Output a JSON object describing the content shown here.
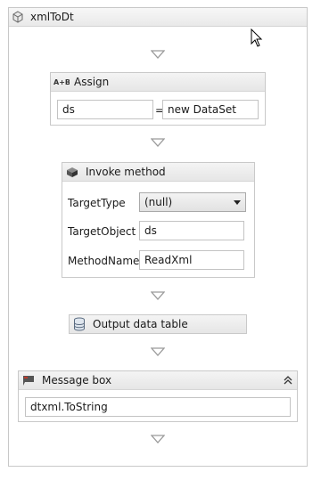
{
  "sequence": {
    "title": "xmlToDt",
    "icon": "sequence-icon"
  },
  "assign": {
    "title": "Assign",
    "icon": "assign-icon",
    "icon_text": "A+B",
    "to_value": "ds",
    "equals": "=",
    "value": "new DataSet"
  },
  "invoke": {
    "title": "Invoke method",
    "icon": "invoke-method-icon",
    "target_type_label": "TargetType",
    "target_type_value": "(null)",
    "target_object_label": "TargetObject",
    "target_object_value": "ds",
    "method_name_label": "MethodName",
    "method_name_value": "ReadXml"
  },
  "output": {
    "title": "Output data table",
    "icon": "database-icon"
  },
  "message": {
    "title": "Message box",
    "icon": "message-box-icon",
    "text_value": "dtxml.ToString",
    "collapse_icon": "collapse-chevron-icon"
  },
  "colors": {
    "border": "#c9c9c9",
    "header_bg": "#ececec",
    "arrow": "#9a9a9a"
  }
}
